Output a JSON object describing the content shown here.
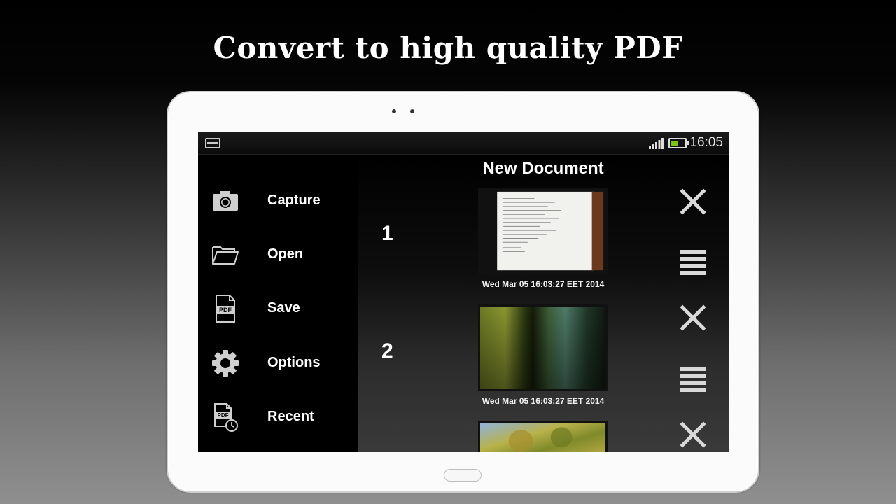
{
  "promo": {
    "headline": "Convert to high quality PDF"
  },
  "statusbar": {
    "time": "16:05",
    "icons": [
      "notification-icon",
      "signal-icon",
      "battery-icon"
    ],
    "battery_color": "#7dc31a"
  },
  "sidebar": {
    "items": [
      {
        "label": "Capture",
        "icon": "camera-icon"
      },
      {
        "label": "Open",
        "icon": "folder-icon"
      },
      {
        "label": "Save",
        "icon": "pdf-file-icon"
      },
      {
        "label": "Options",
        "icon": "gear-icon"
      },
      {
        "label": "Recent",
        "icon": "pdf-recent-icon"
      }
    ]
  },
  "document": {
    "title": "New Document",
    "pages": [
      {
        "number": "1",
        "date": "Wed Mar 05 16:03:27 EET 2014",
        "actions": [
          "delete-icon",
          "reorder-icon"
        ]
      },
      {
        "number": "2",
        "date": "Wed Mar 05 16:03:27 EET 2014",
        "actions": [
          "delete-icon",
          "reorder-icon"
        ]
      },
      {
        "number": "",
        "date": "",
        "actions": [
          "delete-icon"
        ]
      }
    ]
  }
}
